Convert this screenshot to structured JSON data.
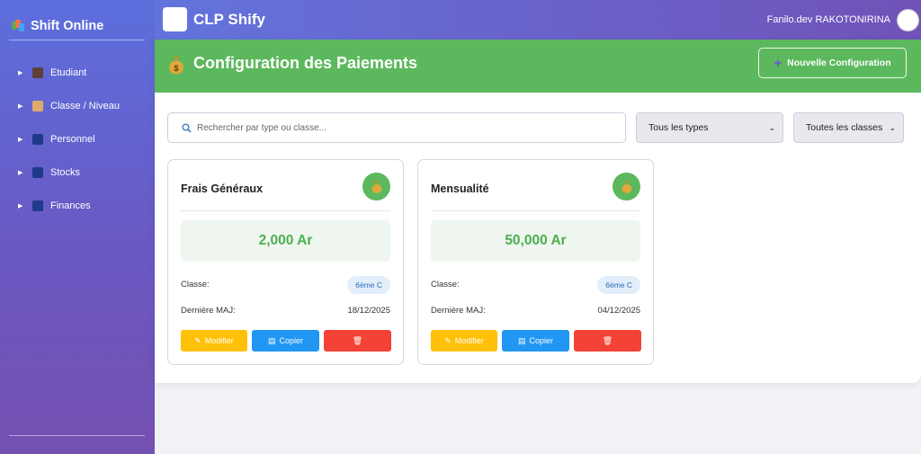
{
  "sidebar": {
    "brand": "Shift Online",
    "items": [
      {
        "label": "Etudiant",
        "icon": "student-icon"
      },
      {
        "label": "Classe / Niveau",
        "icon": "school-icon"
      },
      {
        "label": "Personnel",
        "icon": "staff-icon"
      },
      {
        "label": "Stocks",
        "icon": "stocks-icon"
      },
      {
        "label": "Finances",
        "icon": "finances-icon"
      }
    ]
  },
  "topbar": {
    "app_title": "CLP Shify",
    "user_name": "Fanilo.dev RAKOTONIRINA"
  },
  "header": {
    "title": "Configuration des Paiements",
    "new_button": "Nouvelle Configuration"
  },
  "filters": {
    "search_placeholder": "Rechercher par type ou classe...",
    "type_select": "Tous les types",
    "class_select": "Toutes les classes"
  },
  "cards": [
    {
      "name": "Frais Généraux",
      "amount": "2,000 Ar",
      "class_label": "Classe:",
      "class_value": "6ème C",
      "updated_label": "Dernière MAJ:",
      "updated_value": "18/12/2025",
      "edit_label": "Modifier",
      "copy_label": "Copier"
    },
    {
      "name": "Mensualité",
      "amount": "50,000 Ar",
      "class_label": "Classe:",
      "class_value": "6ème C",
      "updated_label": "Dernière MAJ:",
      "updated_value": "04/12/2025",
      "edit_label": "Modifier",
      "copy_label": "Copier"
    }
  ],
  "colors": {
    "header_green": "#5cb85c",
    "amount_green": "#4caf50",
    "edit_yellow": "#ffc107",
    "copy_blue": "#2196f3",
    "delete_red": "#f44336",
    "sidebar_purple": "#6a58c2"
  }
}
